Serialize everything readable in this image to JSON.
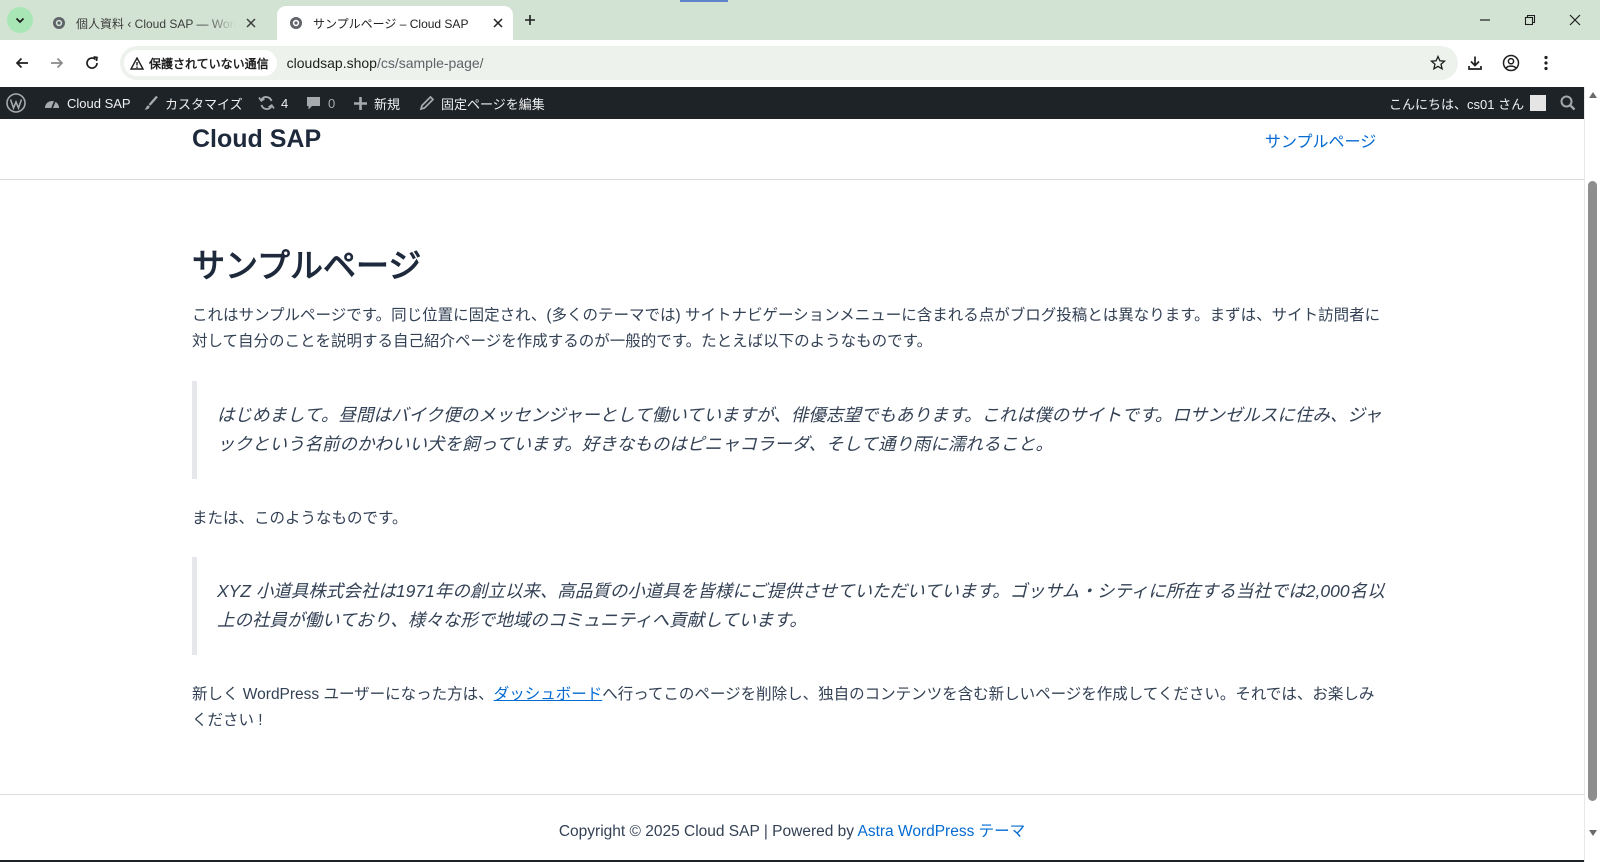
{
  "browser": {
    "tabs": [
      {
        "title": "個人資料 ‹ Cloud SAP — WordPress",
        "active": false
      },
      {
        "title": "サンプルページ – Cloud SAP",
        "active": true
      }
    ],
    "security_label": "保護されていない通信",
    "url_domain": "cloudsap.shop",
    "url_path": "/cs/sample-page/"
  },
  "adminbar": {
    "site_name": "Cloud SAP",
    "customize": "カスタマイズ",
    "updates_count": "4",
    "comments_count": "0",
    "new_label": "新規",
    "edit_page": "固定ページを編集",
    "greeting": "こんにちは、cs01 さん"
  },
  "site": {
    "title": "Cloud SAP",
    "nav": [
      "サンプルページ"
    ]
  },
  "content": {
    "page_title": "サンプルページ",
    "paragraph1": "これはサンプルページです。同じ位置に固定され、(多くのテーマでは) サイトナビゲーションメニューに含まれる点がブログ投稿とは異なります。まずは、サイト訪問者に対して自分のことを説明する自己紹介ページを作成するのが一般的です。たとえば以下のようなものです。",
    "quote1": "はじめまして。昼間はバイク便のメッセンジャーとして働いていますが、俳優志望でもあります。これは僕のサイトです。ロサンゼルスに住み、ジャックという名前のかわいい犬を飼っています。好きなものはピニャコラーダ、そして通り雨に濡れること。",
    "paragraph2": "または、このようなものです。",
    "quote2": "XYZ 小道具株式会社は1971年の創立以来、高品質の小道具を皆様にご提供させていただいています。ゴッサム・シティに所在する当社では2,000名以上の社員が働いており、様々な形で地域のコミュニティへ貢献しています。",
    "paragraph3_before": "新しく WordPress ユーザーになった方は、",
    "paragraph3_link": "ダッシュボード",
    "paragraph3_after": "へ行ってこのページを削除し、独自のコンテンツを含む新しいページを作成してください。それでは、お楽しみください !"
  },
  "footer": {
    "copyright": "Copyright © 2025 Cloud SAP | Powered by ",
    "theme_link": "Astra WordPress テーマ"
  },
  "colors": {
    "link": "#046bd2",
    "adminbar_bg": "#1d2327",
    "tabstrip_bg": "#d3e3d3"
  }
}
